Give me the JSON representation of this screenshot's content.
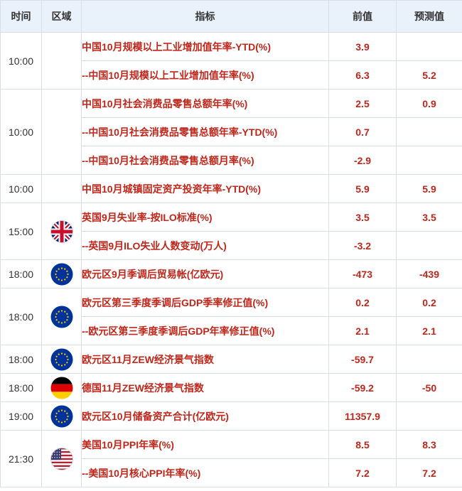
{
  "headers": {
    "time": "时间",
    "region": "区域",
    "indicator": "指标",
    "previous": "前值",
    "forecast": "预测值"
  },
  "groups": [
    {
      "time": "10:00",
      "flag": "china-flag-icon",
      "rows": [
        {
          "indicator": "中国10月规模以上工业增加值年率-YTD(%)",
          "previous": "3.9",
          "forecast": ""
        },
        {
          "indicator": "--中国10月规模以上工业增加值年率(%)",
          "previous": "6.3",
          "forecast": "5.2"
        }
      ]
    },
    {
      "time": "10:00",
      "flag": "china-flag-icon",
      "rows": [
        {
          "indicator": "中国10月社会消费品零售总额年率(%)",
          "previous": "2.5",
          "forecast": "0.9"
        },
        {
          "indicator": "--中国10月社会消费品零售总额年率-YTD(%)",
          "previous": "0.7",
          "forecast": ""
        },
        {
          "indicator": "--中国10月社会消费品零售总额月率(%)",
          "previous": "-2.9",
          "forecast": ""
        }
      ]
    },
    {
      "time": "10:00",
      "flag": "china-flag-icon",
      "rows": [
        {
          "indicator": "中国10月城镇固定资产投资年率-YTD(%)",
          "previous": "5.9",
          "forecast": "5.9"
        }
      ]
    },
    {
      "time": "15:00",
      "flag": "uk-flag-icon",
      "rows": [
        {
          "indicator": "英国9月失业率-按ILO标准(%)",
          "previous": "3.5",
          "forecast": "3.5"
        },
        {
          "indicator": "--英国9月ILO失业人数变动(万人)",
          "previous": "-3.2",
          "forecast": ""
        }
      ]
    },
    {
      "time": "18:00",
      "flag": "eu-flag-icon",
      "rows": [
        {
          "indicator": "欧元区9月季调后贸易帐(亿欧元)",
          "previous": "-473",
          "forecast": "-439"
        }
      ]
    },
    {
      "time": "18:00",
      "flag": "eu-flag-icon",
      "rows": [
        {
          "indicator": "欧元区第三季度季调后GDP季率修正值(%)",
          "previous": "0.2",
          "forecast": "0.2"
        },
        {
          "indicator": "--欧元区第三季度季调后GDP年率修正值(%)",
          "previous": "2.1",
          "forecast": "2.1"
        }
      ]
    },
    {
      "time": "18:00",
      "flag": "eu-flag-icon",
      "rows": [
        {
          "indicator": "欧元区11月ZEW经济景气指数",
          "previous": "-59.7",
          "forecast": ""
        }
      ]
    },
    {
      "time": "18:00",
      "flag": "germany-flag-icon",
      "rows": [
        {
          "indicator": "德国11月ZEW经济景气指数",
          "previous": "-59.2",
          "forecast": "-50"
        }
      ]
    },
    {
      "time": "19:00",
      "flag": "eu-flag-icon",
      "rows": [
        {
          "indicator": "欧元区10月储备资产合计(亿欧元)",
          "previous": "11357.9",
          "forecast": ""
        }
      ]
    },
    {
      "time": "21:30",
      "flag": "us-flag-icon",
      "rows": [
        {
          "indicator": "美国10月PPI年率(%)",
          "previous": "8.5",
          "forecast": "8.3"
        },
        {
          "indicator": "--美国10月核心PPI年率(%)",
          "previous": "7.2",
          "forecast": "7.2"
        }
      ]
    }
  ]
}
